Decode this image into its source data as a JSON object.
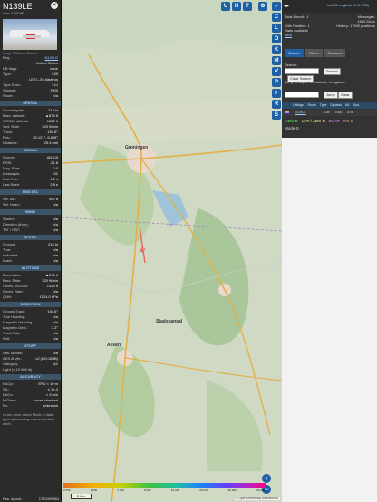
{
  "left_panel": {
    "callsign": "N139LE",
    "hex": "Hex: A0909F",
    "photo_credit": "Image © Marcus Bischof",
    "rows_top": [
      {
        "k": "Reg.:",
        "v": "N139LE"
      },
      {
        "k": "",
        "v": "United States"
      },
      {
        "k": "DB flags:",
        "v": "none"
      },
      {
        "k": "Type:",
        "v": "L39"
      },
      {
        "k": "",
        "v": "LET L-39 Albatros"
      },
      {
        "k": "Type Desc.:",
        "v": "L1J"
      },
      {
        "k": "Squawk:",
        "v": "7000"
      },
      {
        "k": "Route:",
        "v": "n/a"
      }
    ],
    "spatial_title": "SPATIAL",
    "spatial": [
      {
        "k": "Groundspeed:",
        "v": "213 kt"
      },
      {
        "k": "Baro. altitude:",
        "v": "▲875 ft"
      },
      {
        "k": "WGS84 altitude:",
        "v": "1325 ft"
      },
      {
        "k": "Vert. Rate:",
        "v": "320 ft/min"
      },
      {
        "k": "Track:",
        "v": "154.6°"
      },
      {
        "k": "Pos.:",
        "v": "53.121°, 6.628°"
      },
      {
        "k": "Distance:",
        "v": "25.4 nmi"
      }
    ],
    "signal_title": "SIGNAL",
    "signal": [
      {
        "k": "Source:",
        "v": "ADS-B"
      },
      {
        "k": "RSSI:",
        "v": "-21.8"
      },
      {
        "k": "Msg. Rate:",
        "v": "0.0"
      },
      {
        "k": "Messages:",
        "v": "191"
      },
      {
        "k": "Last Pos.:",
        "v": "4.2 s"
      },
      {
        "k": "Last Seen:",
        "v": "2.8 s"
      }
    ],
    "fmssel_title": "FMS SEL",
    "fmssel": [
      {
        "k": "Sel. Alt.:",
        "v": "992 ft"
      },
      {
        "k": "Sel. Head.:",
        "v": "n/a"
      }
    ],
    "wind_title": "WIND",
    "wind": [
      {
        "k": "Speed:",
        "v": "n/a"
      },
      {
        "k": "Direction (from):",
        "v": "n/a"
      },
      {
        "k": "TAT / OAT:",
        "v": "n/a"
      }
    ],
    "speed_title": "SPEED",
    "speed": [
      {
        "k": "Ground:",
        "v": "213 kt"
      },
      {
        "k": "True:",
        "v": "n/a"
      },
      {
        "k": "Indicated:",
        "v": "n/a"
      },
      {
        "k": "Mach:",
        "v": "n/a"
      }
    ],
    "altitude_title": "ALTITUDE",
    "altitude": [
      {
        "k": "Barometric:",
        "v": "▲875 ft"
      },
      {
        "k": "Baro. Rate:",
        "v": "320 ft/min"
      },
      {
        "k": "Geom. WGS84:",
        "v": "1325 ft"
      },
      {
        "k": "Geom. Rate:",
        "v": "n/a"
      },
      {
        "k": "QNH:",
        "v": "1024.0 hPa"
      }
    ],
    "direction_title": "DIRECTION",
    "direction": [
      {
        "k": "Ground Track:",
        "v": "154.6°"
      },
      {
        "k": "True Heading:",
        "v": "n/a"
      },
      {
        "k": "Magnetic Heading:",
        "v": "n/a"
      },
      {
        "k": "Magnetic Decl.:",
        "v": "3.2°"
      },
      {
        "k": "Track Rate:",
        "v": "n/a"
      },
      {
        "k": "Roll:",
        "v": "n/a"
      }
    ],
    "stuff_title": "STUFF",
    "stuff": [
      {
        "k": "Nav. Modes:",
        "v": "n/a"
      },
      {
        "k": "ADS-B Ver.:",
        "v": "v2 (DO-260B)"
      },
      {
        "k": "Category:",
        "v": "A1"
      },
      {
        "k": "Light (< 15 500 lb)",
        "v": ""
      }
    ],
    "accuracy_title": "ACCURACY",
    "accuracy": [
      {
        "k": "NACp:",
        "v": "EPU < 10 m"
      },
      {
        "k": "SIL:",
        "v": "≤ 1e-3"
      },
      {
        "k": "NACv:",
        "v": "< 3 m/s"
      },
      {
        "k": "NICbaro:",
        "v": "cross-checked"
      },
      {
        "k": "Rc:",
        "v": "unknown"
      }
    ],
    "footer": "Learn more about Mode S data type by hovering over each data label.",
    "bottom_k": "Pos. epoch:",
    "bottom_v": "1743409984"
  },
  "map": {
    "letter_buttons": [
      "U",
      "H",
      "T"
    ],
    "side_buttons": [
      "C",
      "L",
      "O",
      "K",
      "M",
      "V",
      "P",
      "I",
      "R",
      "S"
    ],
    "cities": [
      {
        "name": "Groningen"
      },
      {
        "name": "Assen"
      },
      {
        "name": "Stadskanaal"
      }
    ],
    "alt_ticks": [
      "2 000",
      "4 000",
      "6 000",
      "8 000",
      "10 000",
      "20 000",
      "30 000",
      "40 000+"
    ],
    "scale_label": "5 km",
    "osm_credit": "© OpenStreetMap contributors.",
    "zoom_in": "+",
    "zoom_out": "−"
  },
  "right_panel": {
    "top_link": "tar1090 on github (3.14.1733)",
    "total_aircraft_label": "Total Aircraft:",
    "total_aircraft": "1",
    "messages_label": "Messages:",
    "messages": "1690.3/sec",
    "with_position_label": "With Position:",
    "with_position": "1",
    "history_label": "History:",
    "history": "17590 positions",
    "stats_label": "Stats available",
    "stats_link": "here",
    "tabs": [
      "Search",
      "Filters",
      "Columns"
    ],
    "search_label": "Search:",
    "search_button": "Search",
    "clear_search": "Clear Search",
    "jump_label": "Jump to Airport or Latitude, Longitude:",
    "jump_button": "Jump",
    "clear_button": "Clear",
    "table_headers": [
      "Callsign",
      "Route",
      "Type",
      "Squawk",
      "Alt.",
      "Spd."
    ],
    "row": {
      "callsign": "N139LE",
      "route": "",
      "type": "L39",
      "squawk": "7000",
      "alt": "875"
    },
    "tags": [
      "ADS-B",
      "UAT / ADS-R",
      "MLAT",
      "TIS-B"
    ],
    "modes": "Mode-S"
  }
}
